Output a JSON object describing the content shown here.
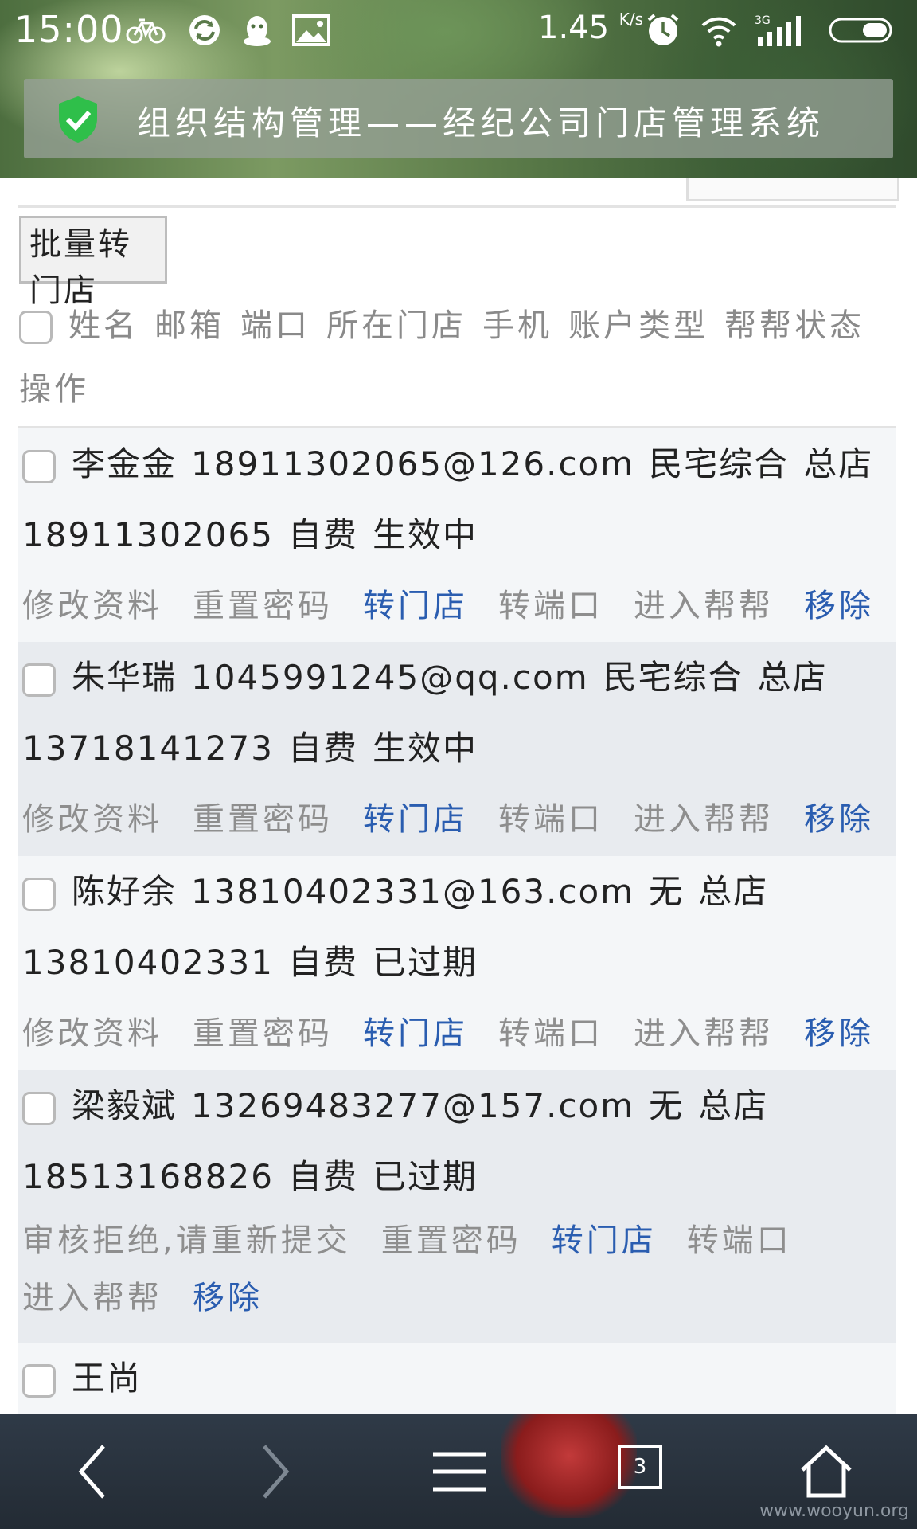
{
  "status_bar": {
    "time": "15:00",
    "speed": "1.45",
    "speed_unit": "K/s",
    "signal_label": "3G"
  },
  "title_bar": {
    "title": "组织结构管理——经纪公司门店管理系统"
  },
  "batch_button": "批量转门店",
  "table_header": [
    "姓名",
    "邮箱",
    "端口",
    "所在门店",
    "手机",
    "账户类型",
    "帮帮状态",
    "操作"
  ],
  "rows": [
    {
      "name": "李金金",
      "email": "18911302065@126.com",
      "port": "民宅综合",
      "store": "总店",
      "phone": "18911302065",
      "account_type": "自费",
      "status": "生效中",
      "actions": [
        "修改资料",
        "重置密码",
        "转门店",
        "转端口",
        "进入帮帮",
        "移除"
      ]
    },
    {
      "name": "朱华瑞",
      "email": "1045991245@qq.com",
      "port": "民宅综合",
      "store": "总店",
      "phone": "13718141273",
      "account_type": "自费",
      "status": "生效中",
      "actions": [
        "修改资料",
        "重置密码",
        "转门店",
        "转端口",
        "进入帮帮",
        "移除"
      ]
    },
    {
      "name": "陈好余",
      "email": "13810402331@163.com",
      "port": "无",
      "store": "总店",
      "phone": "13810402331",
      "account_type": "自费",
      "status": "已过期",
      "actions": [
        "修改资料",
        "重置密码",
        "转门店",
        "转端口",
        "进入帮帮",
        "移除"
      ]
    },
    {
      "name": "梁毅斌",
      "email": "13269483277@157.com",
      "port": "无",
      "store": "总店",
      "phone": "18513168826",
      "account_type": "自费",
      "status": "已过期",
      "actions": [
        "审核拒绝,请重新提交",
        "重置密码",
        "转门店",
        "转端口",
        "进入帮帮",
        "移除"
      ]
    },
    {
      "name": "王尚"
    }
  ],
  "nav": {
    "tab_count": "3"
  },
  "watermark": "www.wooyun.org",
  "colors": {
    "link_blue": "#2a5db0",
    "muted_gray": "#8e8e8e",
    "shield_green": "#2fbf4a"
  }
}
